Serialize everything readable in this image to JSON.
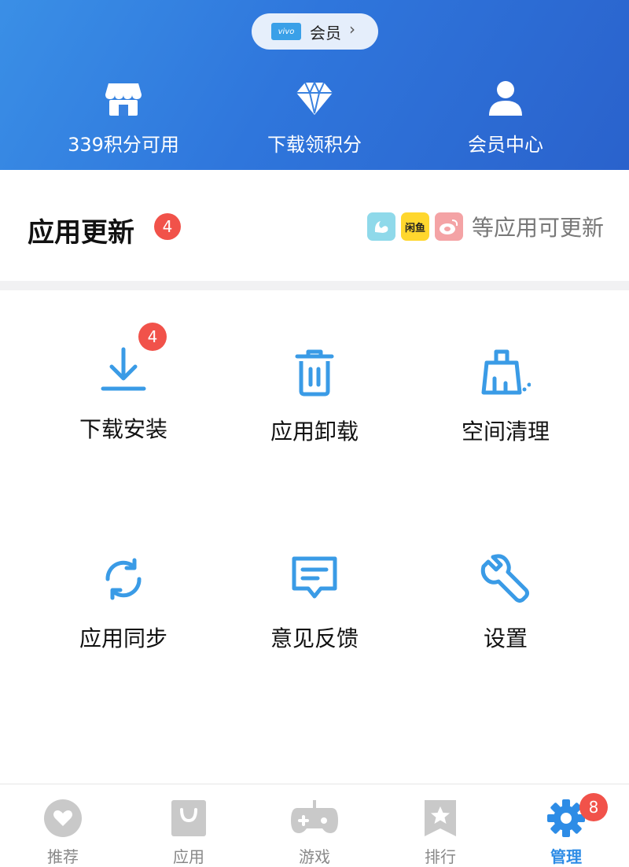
{
  "header": {
    "member_pill": {
      "brand": "vivo",
      "label": "会员",
      "chevron": "›"
    },
    "items": [
      {
        "icon": "store-icon",
        "label": "339积分可用"
      },
      {
        "icon": "diamond-icon",
        "label": "下载领积分"
      },
      {
        "icon": "user-icon",
        "label": "会员中心"
      }
    ]
  },
  "updates": {
    "title": "应用更新",
    "badge": "4",
    "apps": [
      {
        "icon": "uc-browser-icon",
        "text": ""
      },
      {
        "icon": "xianyu-icon",
        "text": "闲鱼"
      },
      {
        "icon": "weibo-icon",
        "text": ""
      }
    ],
    "summary": "等应用可更新"
  },
  "tools": [
    {
      "icon": "download-icon",
      "label": "下载安装",
      "badge": "4"
    },
    {
      "icon": "trash-icon",
      "label": "应用卸载"
    },
    {
      "icon": "broom-icon",
      "label": "空间清理"
    },
    {
      "icon": "sync-icon",
      "label": "应用同步"
    },
    {
      "icon": "feedback-icon",
      "label": "意见反馈"
    },
    {
      "icon": "wrench-icon",
      "label": "设置"
    }
  ],
  "nav": {
    "items": [
      {
        "icon": "heart-icon",
        "label": "推荐"
      },
      {
        "icon": "bag-icon",
        "label": "应用"
      },
      {
        "icon": "gamepad-icon",
        "label": "游戏"
      },
      {
        "icon": "ranking-icon",
        "label": "排行"
      },
      {
        "icon": "gear-icon",
        "label": "管理",
        "active": true
      }
    ],
    "manage_badge": "8"
  },
  "colors": {
    "header_start": "#3a8fe6",
    "header_end": "#2a62cc",
    "accent": "#2d8ce6",
    "badge_red": "#f1524a",
    "icon_blue": "#3a9be6",
    "nav_inactive": "#c9c9c9"
  }
}
